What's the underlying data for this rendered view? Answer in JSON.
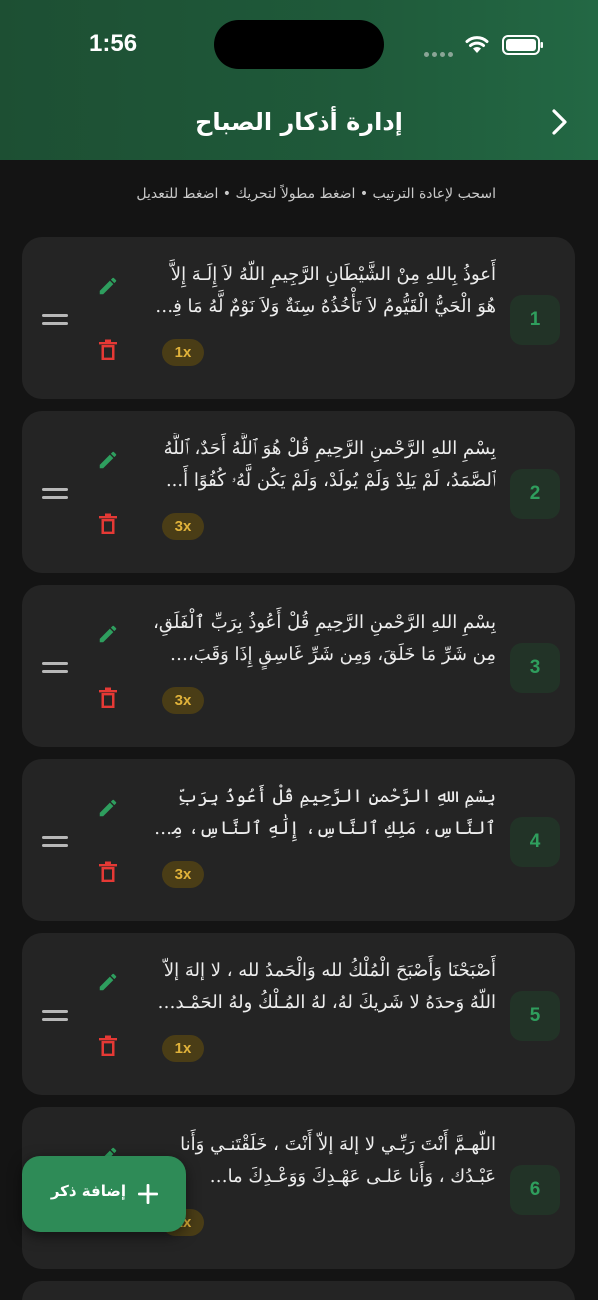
{
  "status_bar": {
    "time": "1:56"
  },
  "header": {
    "title": "إدارة أذكار الصباح"
  },
  "hint": "اسحب لإعادة الترتيب • اضغط مطولاً لتحريك • اضغط للتعديل",
  "items": [
    {
      "number": "1",
      "text": "أَعوذُ بِاللهِ مِنْ الشَّيْطَانِ الرَّجِيمِ اللّهُ لاَ إِلَـهَ إِلاَّ هُوَ الْحَيُّ الْقَيُّومُ لاَ تَأْخُذُهُ سِنَةٌ وَلاَ نَوْمٌ لَّهُ مَا فِي الـ...",
      "repeat": "1x"
    },
    {
      "number": "2",
      "text": "بِسْمِ اللهِ الرَّحْمنِ الرَّحِيمِ قُلْ هُوَ ٱللَّهُ أَحَدٌ، ٱللَّهُ ٱلصَّمَدُ، لَمْ يَلِدْ وَلَمْ يُولَدْ، وَلَمْ يَكُن لَّهُۥ كُفُوًا أَ...",
      "repeat": "3x"
    },
    {
      "number": "3",
      "text": "بِسْمِ اللهِ الرَّحْمنِ الرَّحِيمِ قُلْ أَعُوذُ بِرَبِّ ٱلْفَلَقِ، مِن شَرِّ مَا خَلَقَ، وَمِن شَرِّ غَاسِقٍ إِذَا وَقَبَ، وَمِن شَ...",
      "repeat": "3x"
    },
    {
      "number": "4",
      "text": "بِسْمِ اللهِ الرَّحْمنِ الرَّحِيمِ قُلْ أَعُوذُ بِرَبِّ ٱلنَّاسِ، مَلِكِ ٱلنَّاسِ، إِلَٰهِ ٱلنَّاسِ، مِن شَرِّ ٱلْوَسْوَاسِ ٱلْخَنَّا...",
      "repeat": "3x"
    },
    {
      "number": "5",
      "text": "أَصْبَحْنَا وَأَصْبَحَ الْمُلْكُ لله وَالْحَمدُ لله ، لا إلهَ إلاّ اللّهُ وَحدَهُ لا شَريكَ لهُ، لهُ المُـلْكُ ولهُ الحَمْـد، و...",
      "repeat": "1x"
    },
    {
      "number": "6",
      "text": "اللّهـمَّ أَنْتَ رَبِّـي لا إلهَ إلاّ أَنْتَ ، خَلَقْتَنـي وَأَنا عَبْـدُك ، وَأَنا عَلـى عَهْـدِكَ وَوَعْـدِكَ ما اسْتَـطَعْـت...",
      "repeat": "1x"
    }
  ],
  "fab": {
    "label": "إضافة ذكر"
  },
  "colors": {
    "header_green": "#1f5a3a",
    "accent_green": "#2e8b57",
    "delete_red": "#e53935",
    "badge_gold": "#e0b23a",
    "card_bg": "#242424",
    "screen_bg": "#141414"
  },
  "icons": {
    "back": "chevron-right-icon",
    "drag": "drag-handle-icon",
    "edit": "pencil-icon",
    "delete": "trash-icon",
    "add": "plus-icon"
  }
}
